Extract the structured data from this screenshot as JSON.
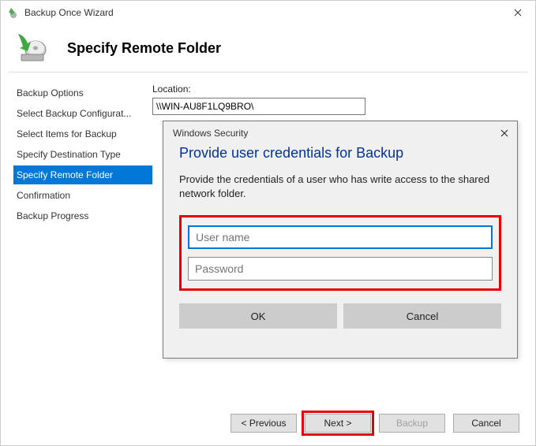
{
  "window": {
    "title": "Backup Once Wizard"
  },
  "header": {
    "title": "Specify Remote Folder"
  },
  "sidebar": {
    "items": [
      {
        "label": "Backup Options",
        "active": false
      },
      {
        "label": "Select Backup Configurat...",
        "active": false
      },
      {
        "label": "Select Items for Backup",
        "active": false
      },
      {
        "label": "Specify Destination Type",
        "active": false
      },
      {
        "label": "Specify Remote Folder",
        "active": true
      },
      {
        "label": "Confirmation",
        "active": false
      },
      {
        "label": "Backup Progress",
        "active": false
      }
    ]
  },
  "main": {
    "location_label": "Location:",
    "location_value": "\\\\WIN-AU8F1LQ9BRO\\"
  },
  "dialog": {
    "title": "Windows Security",
    "heading": "Provide user credentials for Backup",
    "text": "Provide the credentials of a user who has write access to the shared network folder.",
    "username_placeholder": "User name",
    "password_placeholder": "Password",
    "ok_label": "OK",
    "cancel_label": "Cancel"
  },
  "footer": {
    "previous": "< Previous",
    "next": "Next >",
    "backup": "Backup",
    "cancel": "Cancel"
  }
}
